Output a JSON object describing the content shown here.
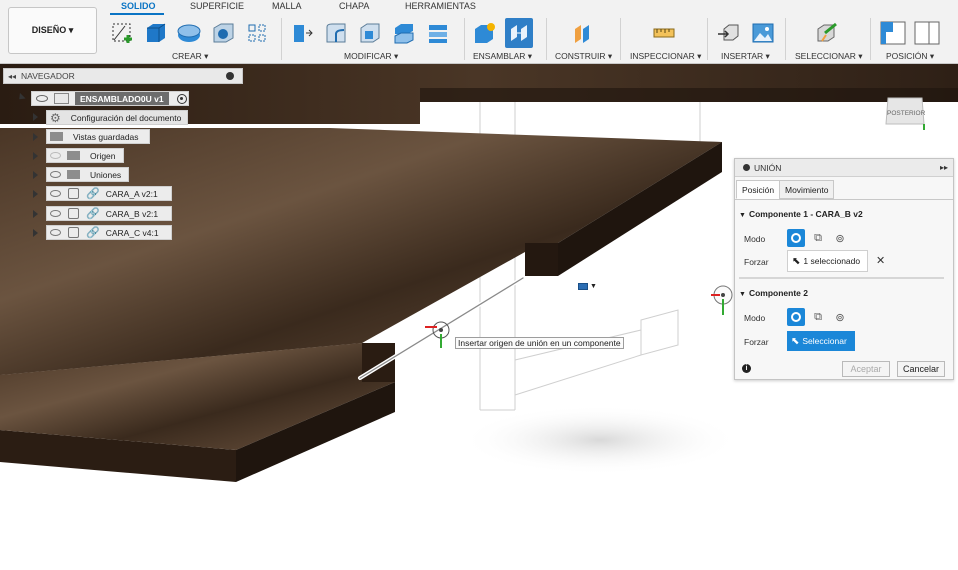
{
  "toolbar": {
    "design_label": "DISEÑO ▾",
    "tabs": [
      "SOLIDO",
      "SUPERFICIE",
      "MALLA",
      "CHAPA",
      "HERRAMIENTAS"
    ],
    "groups": [
      "CREAR ▾",
      "MODIFICAR ▾",
      "ENSAMBLAR ▾",
      "CONSTRUIR ▾",
      "INSPECCIONAR ▾",
      "INSERTAR ▾",
      "SELECCIONAR ▾",
      "POSICIÓN ▾"
    ]
  },
  "navigator": {
    "title": "NAVEGADOR",
    "root": "ENSAMBLADO0U v1",
    "items": [
      {
        "label": "Configuración del documento",
        "icon": "gear-icon"
      },
      {
        "label": "Vistas guardadas",
        "icon": "folder-icon"
      },
      {
        "label": "Origen",
        "icon": "folder-icon"
      },
      {
        "label": "Uniones",
        "icon": "folder-icon"
      },
      {
        "label": "CARA_A v2:1",
        "icon": "link-icon"
      },
      {
        "label": "CARA_B v2:1",
        "icon": "link-icon"
      },
      {
        "label": "CARA_C v4:1",
        "icon": "link-icon"
      }
    ]
  },
  "union_panel": {
    "title": "UNIÓN",
    "tabs": [
      "Posición",
      "Movimiento"
    ],
    "component1_header": "Componente 1 - CARA_B v2",
    "component2_header": "Componente 2",
    "mode_label": "Modo",
    "force_label": "Forzar",
    "component1_selection": "1 seleccionado",
    "component2_selection": "Seleccionar",
    "ok_label": "Aceptar",
    "cancel_label": "Cancelar"
  },
  "tooltip": "Insertar origen de unión en un componente",
  "view_cube_label": "POSTERIOR",
  "colors": {
    "accent": "#0a74c4",
    "select_blue": "#1b87d8",
    "wood_dark": "#3b2a1e",
    "wood_light": "#6b5440"
  }
}
